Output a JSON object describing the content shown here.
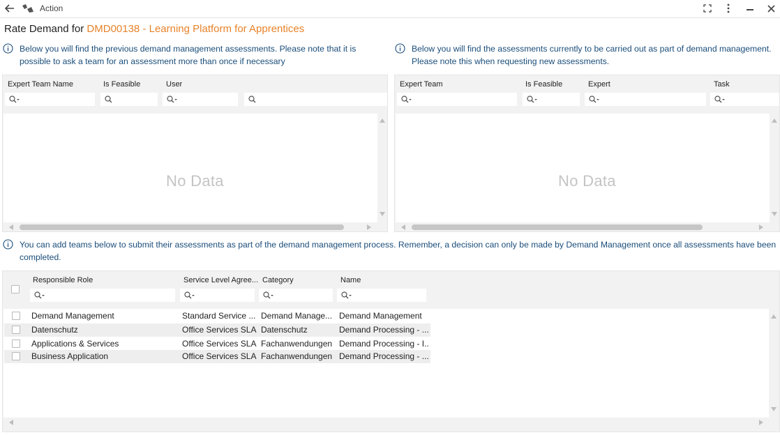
{
  "titlebar": {
    "title": "Action"
  },
  "header": {
    "prefix": "Rate Demand for",
    "demand": "DMD00138 - Learning Platform for Apprentices"
  },
  "info_left": "Below you will find the previous demand management assessments. Please note that it is possible to ask a team for an assessment more than once if necessary",
  "info_right": "Below you will find the assessments currently to be carried out as part of demand management. Please note this when requesting new assessments.",
  "info_bottom": "You can add teams below to submit their assessments as part of the demand management process. Remember, a decision can only be made by Demand Management once all assessments have been completed.",
  "grid_left": {
    "columns": [
      "Expert Team Name",
      "Is Feasible",
      "User"
    ],
    "empty_text": "No Data"
  },
  "grid_right": {
    "columns": [
      "Expert Team",
      "Is Feasible",
      "Expert",
      "Task"
    ],
    "empty_text": "No Data"
  },
  "grid_bottom": {
    "columns": [
      "Responsible Role",
      "Service Level Agree...",
      "Category",
      "Name"
    ],
    "rows": [
      {
        "role": "Demand Management",
        "sla": "Standard Service ...",
        "category": "Demand Manage...",
        "name": "Demand Management"
      },
      {
        "role": "Datenschutz",
        "sla": "Office Services SLA",
        "category": "Datenschutz",
        "name": "Demand Processing - ..."
      },
      {
        "role": "Applications & Services",
        "sla": "Office Services SLA",
        "category": "Fachanwendungen",
        "name": "Demand Processing - I..."
      },
      {
        "role": "Business Application",
        "sla": "Office Services SLA",
        "category": "Fachanwendungen",
        "name": "Demand Processing - ..."
      }
    ]
  },
  "colors": {
    "accent": "#e8832a",
    "info_text": "#1a4d7a"
  }
}
